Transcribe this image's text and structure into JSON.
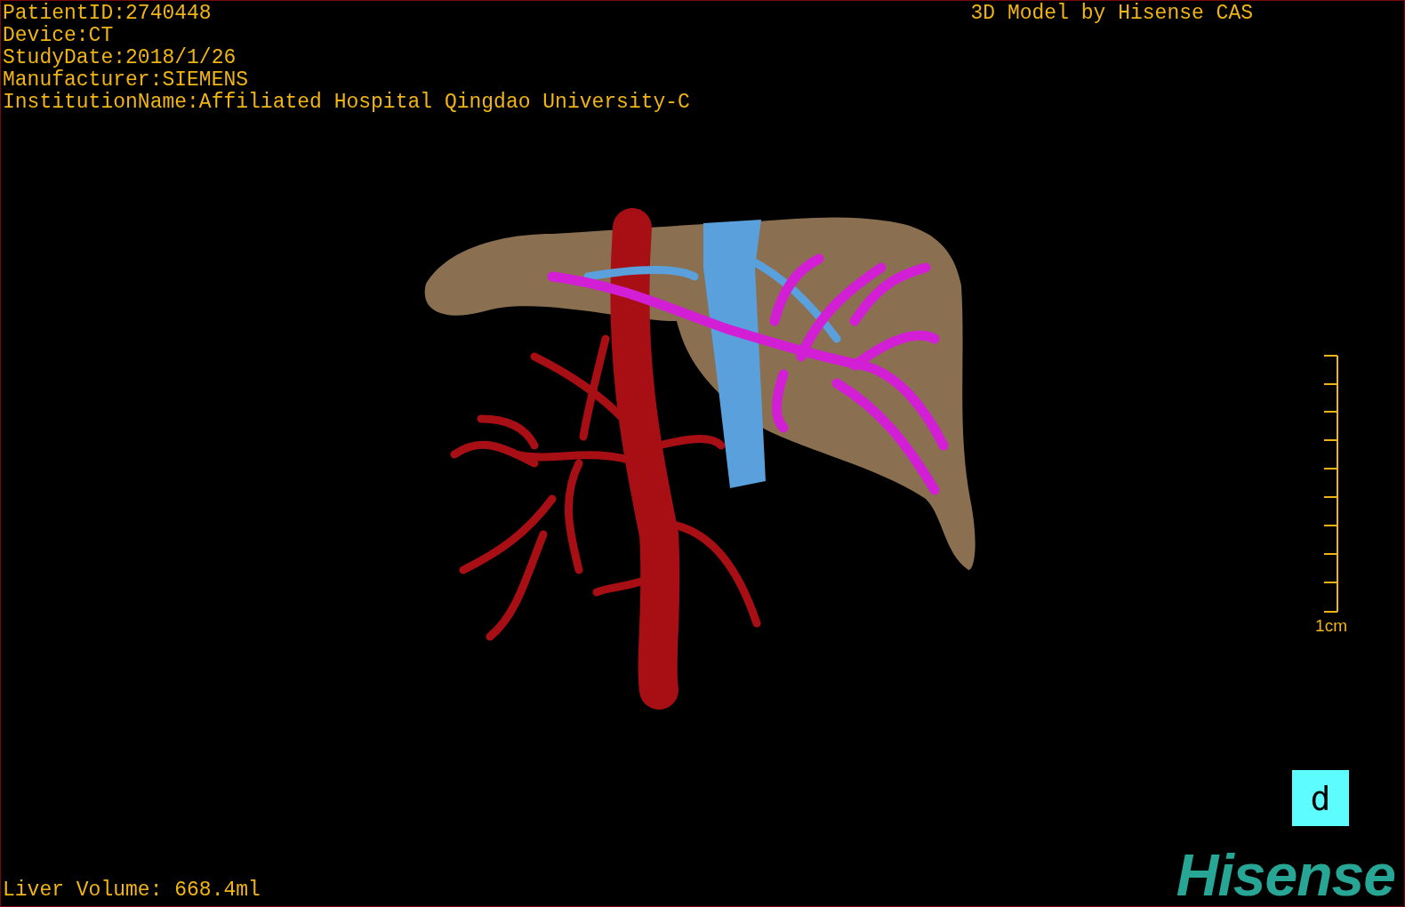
{
  "info_lines": [
    "PatientID:2740448",
    "Device:CT",
    "StudyDate:2018/1/26",
    "Manufacturer:SIEMENS",
    "InstitutionName:Affiliated Hospital Qingdao University-C"
  ],
  "title": "3D Model by Hisense CAS",
  "scale": {
    "label": "1cm"
  },
  "view_button": "d",
  "liver_volume": "Liver Volume: 668.4ml",
  "logo": "Hisense"
}
